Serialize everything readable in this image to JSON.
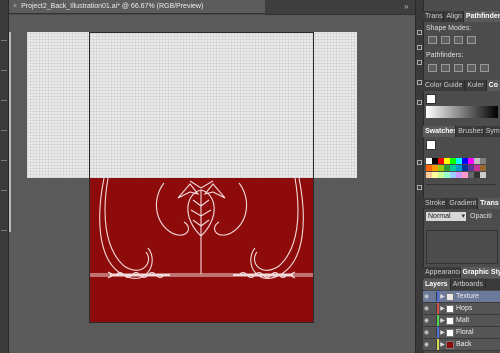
{
  "document": {
    "tab_title": "Project2_Back_Illustration01.ai* @ 66.67% (RGB/Preview)",
    "close_glyph": "×"
  },
  "panels": {
    "top_tabs": [
      "Trans",
      "Align",
      "Pathfinder"
    ],
    "shape_modes_label": "Shape Modes:",
    "pathfinders_label": "Pathfinders:",
    "color_tabs": [
      "Color Guide",
      "Kuler",
      "Co"
    ],
    "swatch_tabs": [
      "Swatches",
      "Brushes",
      "Sym"
    ],
    "stroke_tabs": [
      "Stroke",
      "Gradient",
      "Trans"
    ],
    "blend_mode": "Normal",
    "opacity_label": "Opaciti",
    "appearance_tabs": [
      "Appearance",
      "Graphic Styl"
    ],
    "layers_tabs": [
      "Layers",
      "Artboards"
    ],
    "layers": [
      {
        "name": "Texture",
        "color": "#4f6fd6",
        "thumb": "#e9e9e9",
        "selected": true
      },
      {
        "name": "Hops",
        "color": "#d64f4f",
        "thumb": "#ffffff",
        "selected": false
      },
      {
        "name": "Malt",
        "color": "#4fd64f",
        "thumb": "#ffffff",
        "selected": false
      },
      {
        "name": "Floral",
        "color": "#4f6fd6",
        "thumb": "#ffffff",
        "selected": false
      },
      {
        "name": "Back",
        "color": "#d6d64f",
        "thumb": "#8d0b0b",
        "selected": false
      }
    ],
    "swatch_colors": [
      [
        "#ffffff",
        "#000000",
        "#ff0000",
        "#ffff00",
        "#00ff00",
        "#00ffff",
        "#0000ff",
        "#ff00ff",
        "#c0c0c0",
        "#808080"
      ],
      [
        "#ff6600",
        "#ff9900",
        "#99cc00",
        "#339933",
        "#00cc99",
        "#0099cc",
        "#003399",
        "#663399",
        "#cc3399",
        "#996633"
      ],
      [
        "#ffcc99",
        "#ffff99",
        "#ccff99",
        "#99ffcc",
        "#99ccff",
        "#cc99ff",
        "#ff99cc",
        "#666666",
        "#333333",
        "#cccccc"
      ]
    ]
  },
  "colors": {
    "artboard_red": "#8d0b0b",
    "texture_gray": "#e9e9e9",
    "line_art": "#f3dada"
  }
}
